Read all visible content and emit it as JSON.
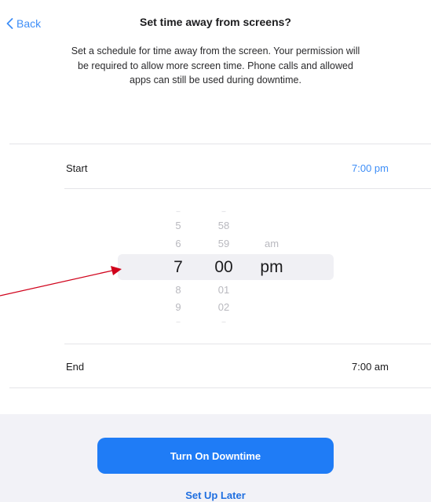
{
  "nav": {
    "back_label": "Back",
    "title": "Set time away from screens?"
  },
  "description": "Set a schedule for time away from the screen. Your permission will be required to allow more screen time. Phone calls and allowed apps can still be used during downtime.",
  "start_row": {
    "label": "Start",
    "value": "7:00 pm"
  },
  "picker": {
    "hours": [
      "5",
      "6",
      "7",
      "8",
      "9"
    ],
    "minutes": [
      "58",
      "59",
      "00",
      "01",
      "02"
    ],
    "periods": [
      "am",
      "pm"
    ],
    "selected": {
      "hour": "7",
      "minute": "00",
      "period": "pm"
    }
  },
  "end_row": {
    "label": "End",
    "value": "7:00 am"
  },
  "buttons": {
    "primary": "Turn On Downtime",
    "secondary": "Set Up Later"
  },
  "colors": {
    "accent": "#3e8ef7",
    "primary_button": "#1f7cf6",
    "annotation_arrow": "#d0021b"
  }
}
